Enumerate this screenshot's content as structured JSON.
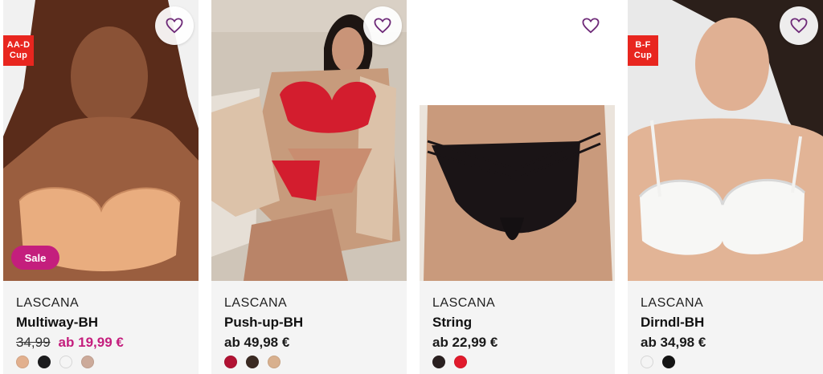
{
  "products": [
    {
      "badge_cup": "AA-D Cup",
      "badge_sale": "Sale",
      "brand": "LASCANA",
      "name": "Multiway-BH",
      "old_price": "34,99",
      "price": "ab 19,99 €",
      "swatches": [
        "#e2b08e",
        "#1c1c1e",
        "#f5f5f5",
        "#ccaa9a"
      ]
    },
    {
      "brand": "LASCANA",
      "name": "Push-up-BH",
      "price": "ab 49,98 €",
      "swatches": [
        "#b11233",
        "#3a2a22",
        "#d8b08e"
      ]
    },
    {
      "brand": "LASCANA",
      "name": "String",
      "price": "ab 22,99 €",
      "swatches": [
        "#2a2020",
        "#e11a2c"
      ]
    },
    {
      "badge_cup": "B-F Cup",
      "brand": "LASCANA",
      "name": "Dirndl-BH",
      "price": "ab 34,98 €",
      "swatches": [
        "#f4f4f4",
        "#141414"
      ]
    }
  ],
  "colors": {
    "accent": "#c41e7d",
    "cup_badge": "#e8261f",
    "heart": "#6e2a78"
  }
}
